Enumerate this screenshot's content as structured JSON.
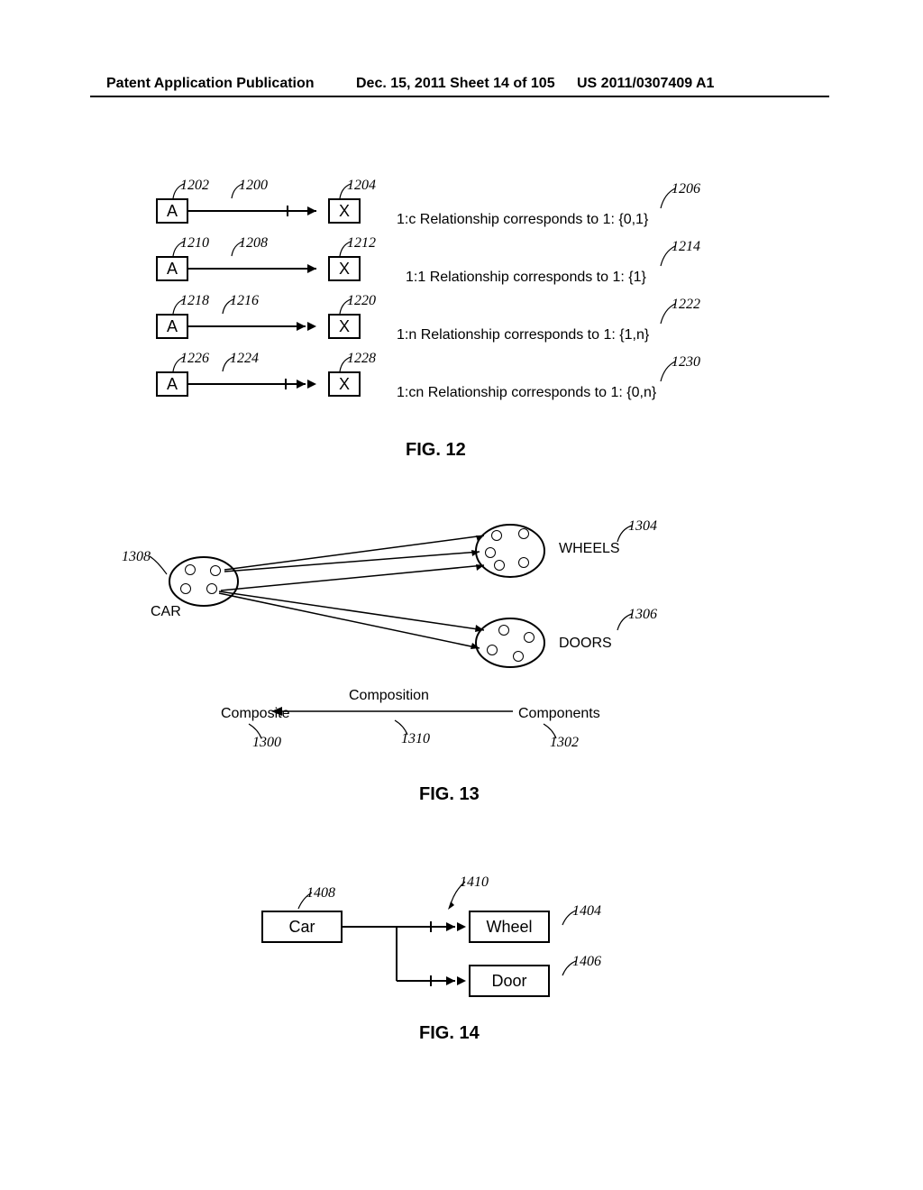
{
  "header": {
    "left": "Patent Application Publication",
    "center": "Dec. 15, 2011  Sheet 14 of 105",
    "right": "US 2011/0307409 A1"
  },
  "fig12": {
    "title": "FIG. 12",
    "rows": [
      {
        "boxA": "A",
        "boxX": "X",
        "refA": "1202",
        "refArrow": "1200",
        "refX": "1204",
        "refDesc": "1206",
        "desc": "1:c Relationship corresponds to 1: {0,1}",
        "arrow": "single-break"
      },
      {
        "boxA": "A",
        "boxX": "X",
        "refA": "1210",
        "refArrow": "1208",
        "refX": "1212",
        "refDesc": "1214",
        "desc": "1:1 Relationship corresponds to 1: {1}",
        "arrow": "single"
      },
      {
        "boxA": "A",
        "boxX": "X",
        "refA": "1218",
        "refArrow": "1216",
        "refX": "1220",
        "refDesc": "1222",
        "desc": "1:n Relationship corresponds to 1: {1,n}",
        "arrow": "double"
      },
      {
        "boxA": "A",
        "boxX": "X",
        "refA": "1226",
        "refArrow": "1224",
        "refX": "1228",
        "refDesc": "1230",
        "desc": "1:cn Relationship corresponds to 1: {0,n}",
        "arrow": "double-break"
      }
    ]
  },
  "fig13": {
    "title": "FIG. 13",
    "carLabel": "CAR",
    "wheelsLabel": "WHEELS",
    "doorsLabel": "DOORS",
    "compositeLabel": "Composite",
    "compositionLabel": "Composition",
    "componentsLabel": "Components",
    "ref1308": "1308",
    "ref1304": "1304",
    "ref1306": "1306",
    "ref1300": "1300",
    "ref1310": "1310",
    "ref1302": "1302"
  },
  "fig14": {
    "title": "FIG. 14",
    "carLabel": "Car",
    "wheelLabel": "Wheel",
    "doorLabel": "Door",
    "ref1408": "1408",
    "ref1410": "1410",
    "ref1404": "1404",
    "ref1406": "1406"
  }
}
